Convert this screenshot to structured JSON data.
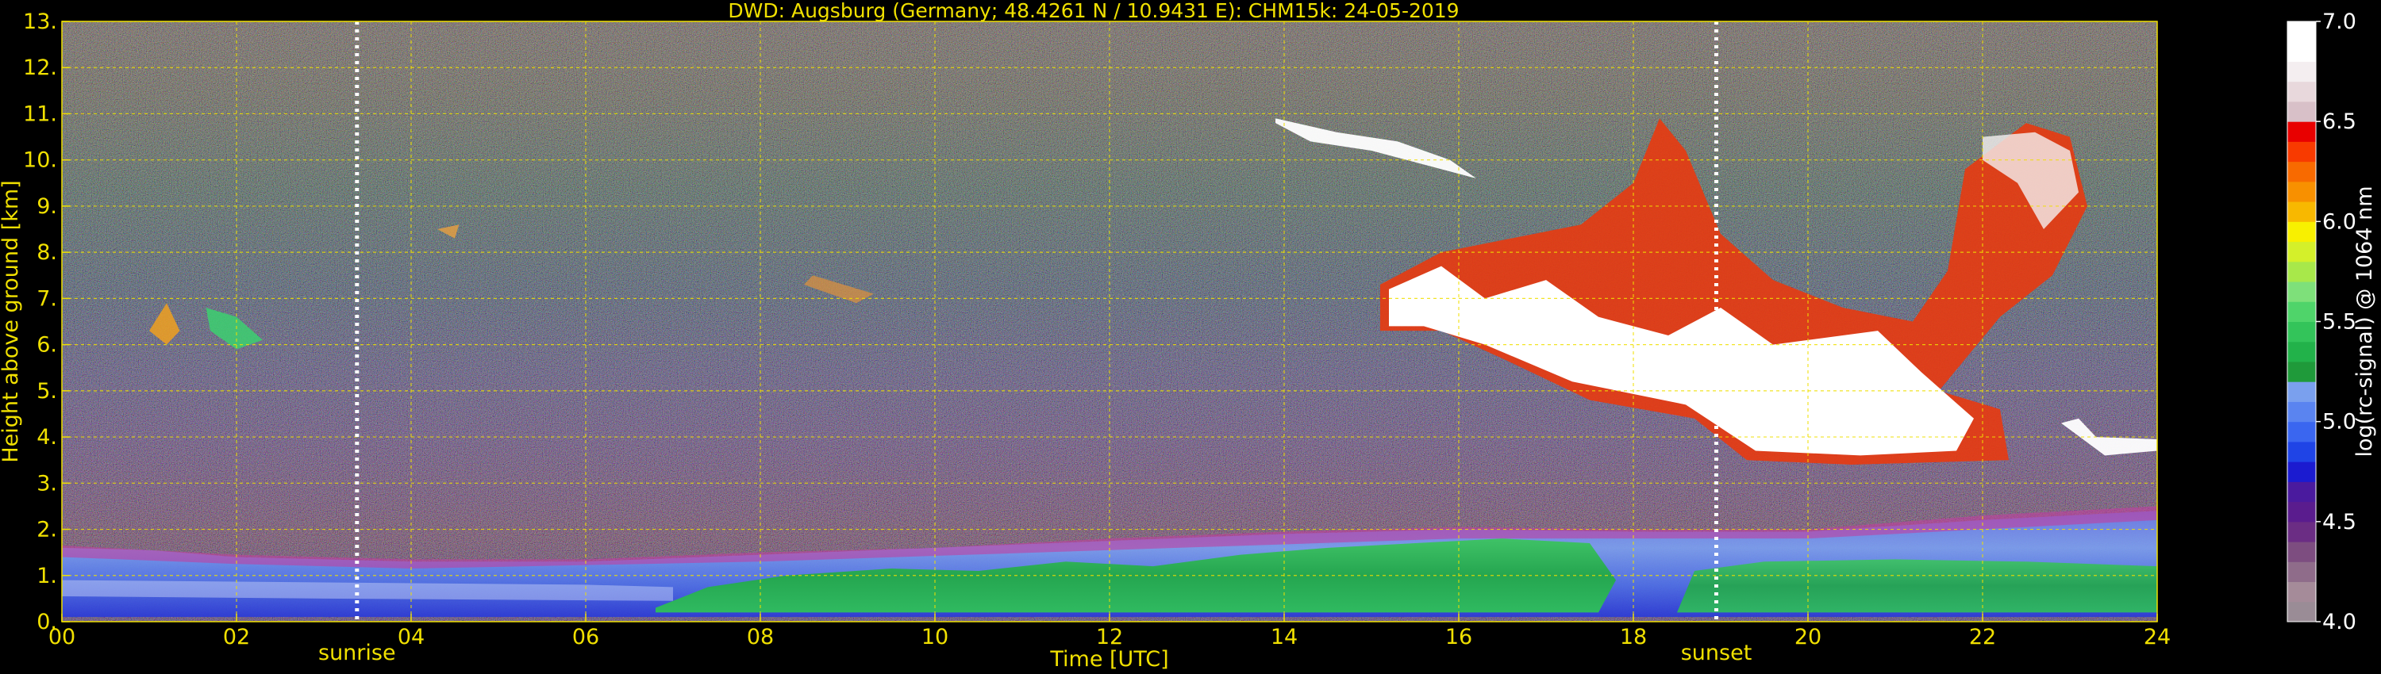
{
  "chart_data": {
    "type": "heatmap",
    "title": "DWD: Augsburg (Germany; 48.4261 N / 10.9431 E):    CHM15k: 24-05-2019",
    "xlabel": "Time [UTC]",
    "ylabel": "Height above ground [km]",
    "x_ticks": [
      "00",
      "02",
      "04",
      "06",
      "08",
      "10",
      "12",
      "14",
      "16",
      "18",
      "20",
      "22",
      "24"
    ],
    "xlim": [
      0,
      24
    ],
    "y_ticks": [
      "0.",
      "1.",
      "2.",
      "3.",
      "4.",
      "5.",
      "6.",
      "7.",
      "8.",
      "9.",
      "10.",
      "11.",
      "12.",
      "13."
    ],
    "ylim": [
      0,
      13
    ],
    "grid": true,
    "sunrise": {
      "label": "sunrise",
      "time": 3.38
    },
    "sunset": {
      "label": "sunset",
      "time": 18.95
    },
    "colorbar": {
      "label": "log(rc-signal) @ 1064 nm",
      "range": [
        4.0,
        7.0
      ],
      "ticks": [
        "4.0",
        "4.5",
        "5.0",
        "5.5",
        "6.0",
        "6.5",
        "7.0"
      ],
      "colors": [
        "#9a8c96",
        "#a58b99",
        "#8f6c8a",
        "#7d4d80",
        "#6b2d84",
        "#5a1c8e",
        "#4a1a9e",
        "#1b1bd0",
        "#1f44e6",
        "#3a66f0",
        "#5a84f0",
        "#7aa0ee",
        "#1f9a3a",
        "#22b24a",
        "#33c45a",
        "#4fd46a",
        "#7ee07a",
        "#a8e84a",
        "#d4f02a",
        "#f8f000",
        "#f8b800",
        "#f89000",
        "#f86a00",
        "#f83a00",
        "#e80000",
        "#d8c0c8",
        "#e8d8dc",
        "#f4eef0",
        "#ffffff",
        "#ffffff"
      ]
    },
    "features": [
      {
        "name": "boundary layer aerosol",
        "time": [
          0,
          24
        ],
        "height": [
          0.1,
          2.0
        ]
      },
      {
        "name": "low cloud fragments",
        "time": [
          1.0,
          2.3
        ],
        "height": [
          5.9,
          7.0
        ]
      },
      {
        "name": "cirrus layer",
        "time": [
          15.0,
          23.6
        ],
        "height": [
          3.5,
          10.8
        ]
      }
    ]
  }
}
